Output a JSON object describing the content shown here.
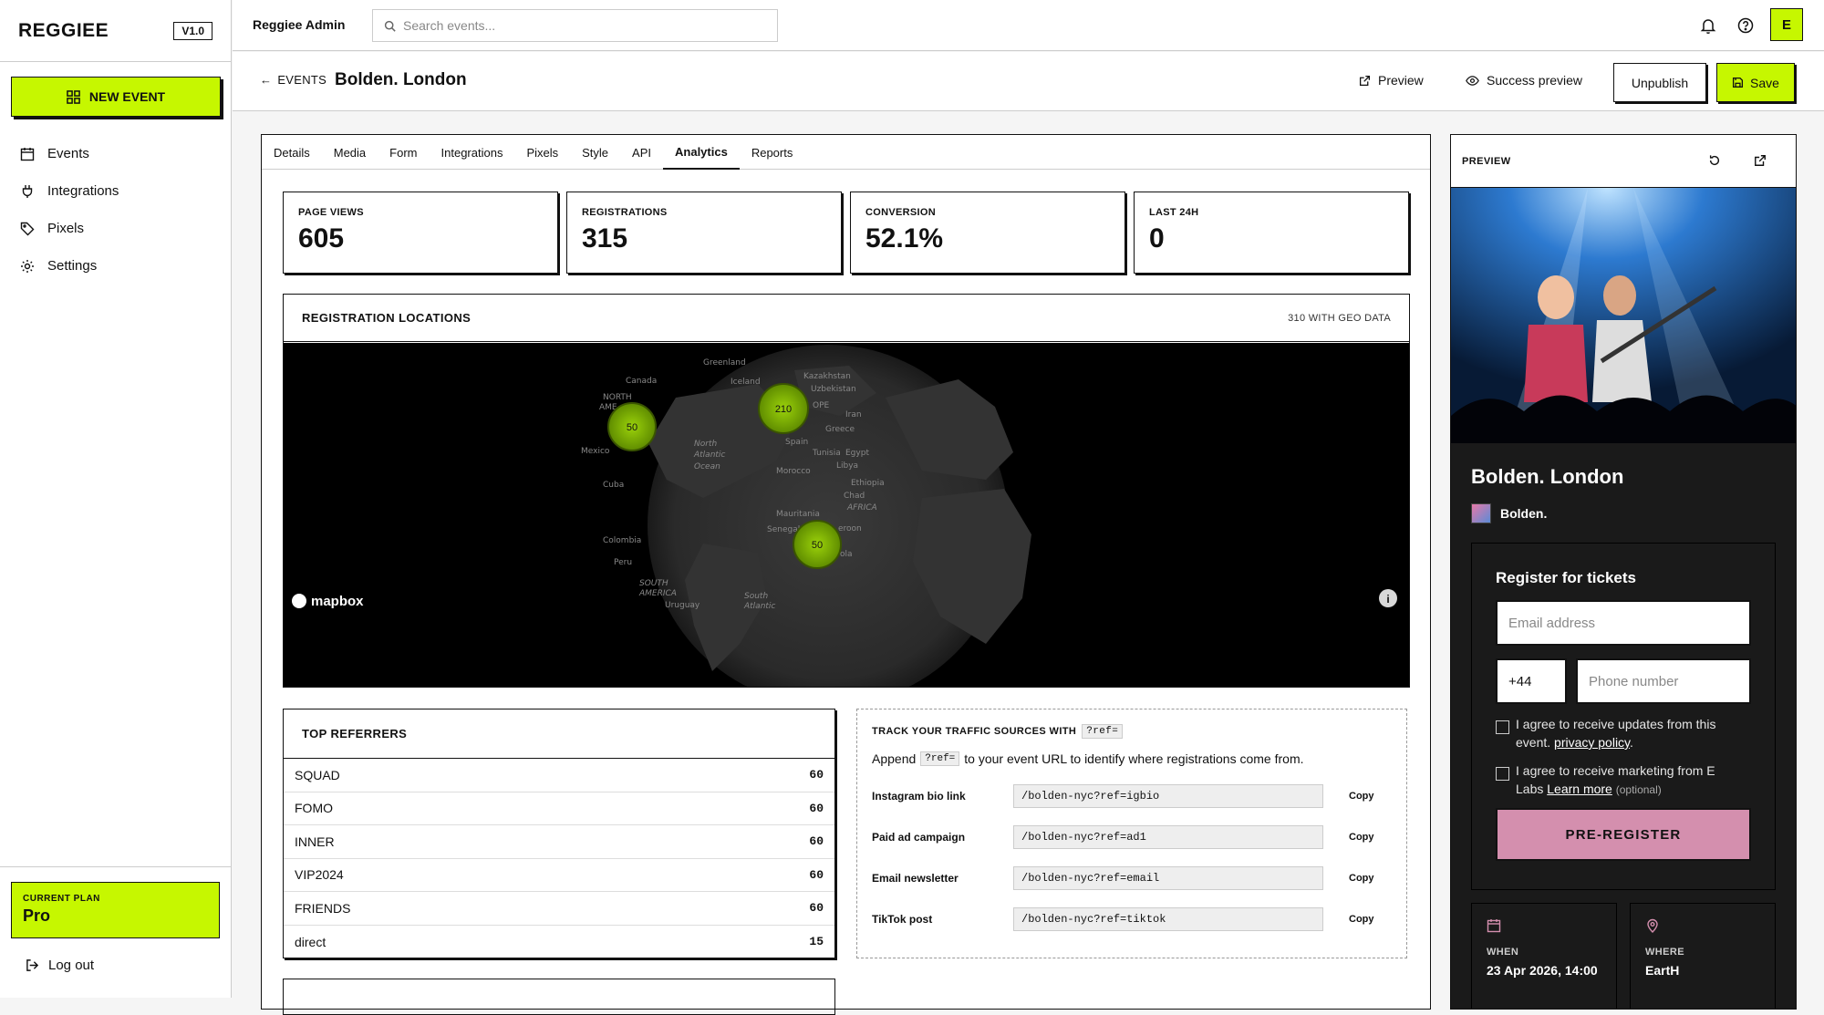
{
  "app": {
    "logo": "REGGIEE",
    "version": "V1.0",
    "admin_title": "Reggiee Admin",
    "avatar": "E"
  },
  "search": {
    "placeholder": "Search events..."
  },
  "sidebar": {
    "new_event": "NEW EVENT",
    "items": [
      {
        "label": "Events",
        "icon": "calendar-icon"
      },
      {
        "label": "Integrations",
        "icon": "plug-icon"
      },
      {
        "label": "Pixels",
        "icon": "tag-icon"
      },
      {
        "label": "Settings",
        "icon": "gear-icon"
      }
    ],
    "plan_label": "CURRENT PLAN",
    "plan_value": "Pro",
    "logout": "Log out"
  },
  "header": {
    "back": "EVENTS",
    "title": "Bolden. London",
    "preview": "Preview",
    "success_preview": "Success preview",
    "unpublish": "Unpublish",
    "save": "Save"
  },
  "tabs": [
    "Details",
    "Media",
    "Form",
    "Integrations",
    "Pixels",
    "Style",
    "API",
    "Analytics",
    "Reports"
  ],
  "active_tab": "Analytics",
  "stats": [
    {
      "label": "PAGE VIEWS",
      "value": "605"
    },
    {
      "label": "REGISTRATIONS",
      "value": "315"
    },
    {
      "label": "CONVERSION",
      "value": "52.1%"
    },
    {
      "label": "LAST 24H",
      "value": "0"
    }
  ],
  "locations": {
    "title": "REGISTRATION LOCATIONS",
    "count": "310 WITH GEO DATA",
    "attribution": "mapbox",
    "clusters": [
      "50",
      "210",
      "50"
    ],
    "labels": [
      "Greenland",
      "Canada",
      "Iceland",
      "Kazakhstan",
      "Uzbekistan",
      "NORTH",
      "AME",
      "OPE",
      "Iran",
      "Greece",
      "Spain",
      "Tunisia",
      "Egypt",
      "Libya",
      "Morocco",
      "Mexico",
      "North",
      "Atlantic",
      "Ocean",
      "Ethiopia",
      "Chad",
      "AFRICA",
      "Cuba",
      "Mauritania",
      "Senegal",
      "eroon",
      "ola",
      "Colombia",
      "Peru",
      "SOUTH",
      "AMERICA",
      "Uruguay",
      "South",
      "Atlantic"
    ]
  },
  "referrers": {
    "title": "TOP REFERRERS",
    "rows": [
      {
        "name": "SQUAD",
        "count": "60"
      },
      {
        "name": "FOMO",
        "count": "60"
      },
      {
        "name": "INNER",
        "count": "60"
      },
      {
        "name": "VIP2024",
        "count": "60"
      },
      {
        "name": "FRIENDS",
        "count": "60"
      },
      {
        "name": "direct",
        "count": "15"
      }
    ]
  },
  "tracking": {
    "title": "TRACK YOUR TRAFFIC SOURCES WITH",
    "param": "?ref=",
    "desc_before": "Append",
    "desc_after": "to your event URL to identify where registrations come from.",
    "copy": "Copy",
    "rows": [
      {
        "label": "Instagram bio link",
        "url": "/bolden-nyc?ref=igbio"
      },
      {
        "label": "Paid ad campaign",
        "url": "/bolden-nyc?ref=ad1"
      },
      {
        "label": "Email newsletter",
        "url": "/bolden-nyc?ref=email"
      },
      {
        "label": "TikTok post",
        "url": "/bolden-nyc?ref=tiktok"
      }
    ]
  },
  "preview": {
    "label": "PREVIEW",
    "title": "Bolden. London",
    "artist": "Bolden.",
    "register_title": "Register for tickets",
    "email_placeholder": "Email address",
    "country_code": "+44",
    "phone_placeholder": "Phone number",
    "consent1_text": "I agree to receive updates from this event.",
    "consent1_link": "privacy policy",
    "consent2_text": "I agree to receive marketing from E Labs",
    "consent2_link": "Learn more",
    "consent2_optional": "(optional)",
    "button": "PRE-REGISTER",
    "when_label": "WHEN",
    "when_value": "23 Apr 2026, 14:00",
    "where_label": "WHERE",
    "where_value": "EartH"
  },
  "colors": {
    "accent": "#c6f700",
    "button_pink": "#d48fae",
    "dark": "#1a1a1a",
    "cluster": "#8cc20a"
  }
}
